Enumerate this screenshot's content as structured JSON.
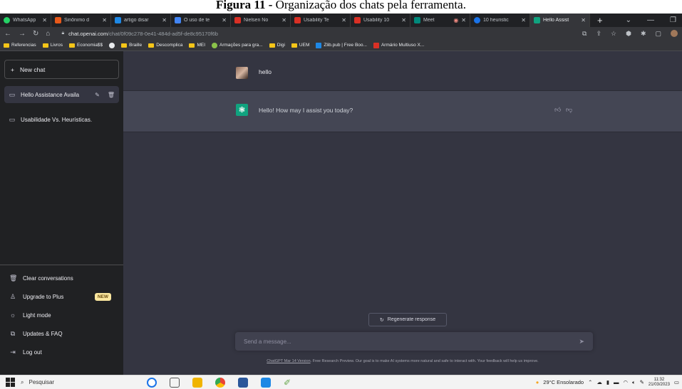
{
  "caption": {
    "bold": "Figura 11 -",
    "rest": "Organização dos chats pela ferramenta."
  },
  "tabs": [
    {
      "label": "WhatsApp",
      "color": "#25d366"
    },
    {
      "label": "Sinônimo d",
      "color": "#e8591a"
    },
    {
      "label": "artigo disar",
      "color": "#1e88e5"
    },
    {
      "label": "O uso de te",
      "color": "#4285f4"
    },
    {
      "label": "Nielsen No",
      "color": "#d93025"
    },
    {
      "label": "Usability Te",
      "color": "#d93025"
    },
    {
      "label": "Usability 10",
      "color": "#d93025"
    },
    {
      "label": "Meet",
      "color": "#00897b"
    },
    {
      "label": "10 heuristic",
      "color": "#1a73e8"
    },
    {
      "label": "Hello Assist",
      "color": "#10a37f",
      "active": true
    }
  ],
  "address": {
    "host": "chat.openai.com",
    "path": "/chat/0f09c278-0e41-484d-ad5f-de8c95170f6b"
  },
  "bookmarks": [
    {
      "label": "Referencias",
      "type": "folder"
    },
    {
      "label": "Livros",
      "type": "folder"
    },
    {
      "label": "Economia$$",
      "type": "folder"
    },
    {
      "label": "",
      "type": "icon",
      "color": "#e8eaed"
    },
    {
      "label": "Braille",
      "type": "folder"
    },
    {
      "label": "Descomplica",
      "type": "folder"
    },
    {
      "label": "MEI",
      "type": "folder"
    },
    {
      "label": "Armações para gra...",
      "type": "icon",
      "color": "#8bc34a"
    },
    {
      "label": "Digi",
      "type": "folder"
    },
    {
      "label": "UEM",
      "type": "folder"
    },
    {
      "label": "Zlib.pub | Free Boo...",
      "type": "icon",
      "color": "#1e88e5"
    },
    {
      "label": "Armário Multiuso X...",
      "type": "icon",
      "color": "#d93025"
    }
  ],
  "sidebar": {
    "new_chat": "New chat",
    "chats": [
      "Hello Assistance Availa",
      "Usabilidade Vs. Heurísticas."
    ],
    "bottom": [
      {
        "label": "Clear conversations",
        "icon": "trash-icon"
      },
      {
        "label": "Upgrade to Plus",
        "icon": "user-icon",
        "badge": "NEW"
      },
      {
        "label": "Light mode",
        "icon": "sun-icon"
      },
      {
        "label": "Updates & FAQ",
        "icon": "external-link-icon"
      },
      {
        "label": "Log out",
        "icon": "logout-icon"
      }
    ]
  },
  "conversation": {
    "user_message": "hello",
    "assistant_message": "Hello! How may I assist you today?"
  },
  "composer": {
    "regenerate_label": "Regenerate response",
    "placeholder": "Send a message..."
  },
  "footer": {
    "link": "ChatGPT Mar 14 Version",
    "text": ". Free Research Preview. Our goal is to make AI systems more natural and safe to interact with. Your feedback will help us improve."
  },
  "taskbar": {
    "search": "Pesquisar",
    "weather": "29°C  Ensolarado",
    "time": "11:32",
    "date": "21/03/2023"
  },
  "colors": {
    "sidebar": "#202123",
    "main": "#343541",
    "assistant_row": "#444654",
    "accent": "#10a37f"
  }
}
